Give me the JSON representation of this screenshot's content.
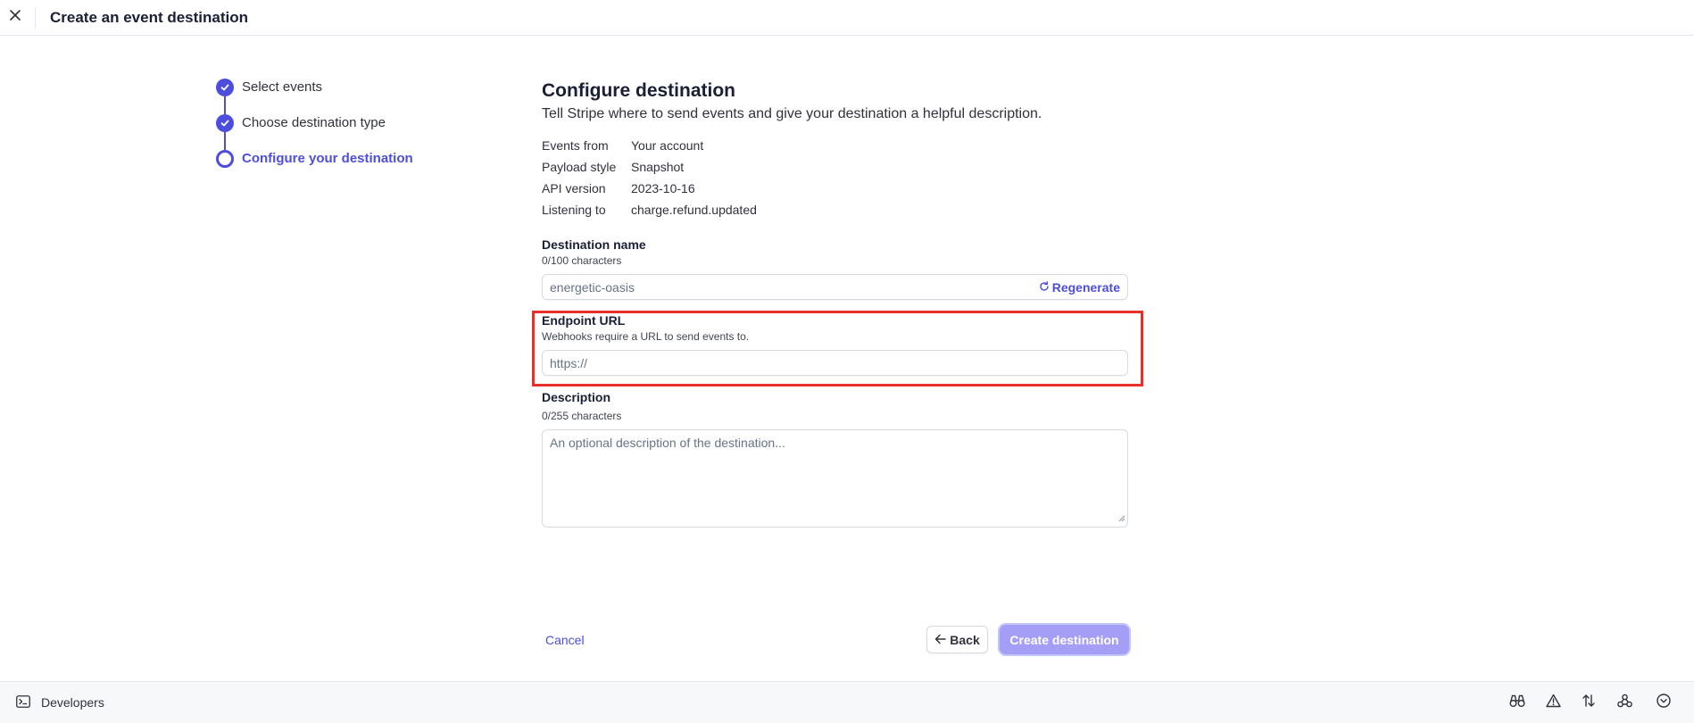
{
  "header": {
    "title": "Create an event destination",
    "close_icon": "close-icon"
  },
  "steps": [
    {
      "label": "Select events",
      "state": "done"
    },
    {
      "label": "Choose destination type",
      "state": "done"
    },
    {
      "label": "Configure your destination",
      "state": "current"
    }
  ],
  "main": {
    "heading": "Configure destination",
    "subtitle": "Tell Stripe where to send events and give your destination a helpful description.",
    "summary": [
      {
        "key": "Events from",
        "value": "Your account"
      },
      {
        "key": "Payload style",
        "value": "Snapshot"
      },
      {
        "key": "API version",
        "value": "2023-10-16"
      },
      {
        "key": "Listening to",
        "value": "charge.refund.updated"
      }
    ],
    "destination_name": {
      "label": "Destination name",
      "help": "0/100 characters",
      "placeholder": "energetic-oasis",
      "regenerate_label": "Regenerate"
    },
    "endpoint_url": {
      "label": "Endpoint URL",
      "help": "Webhooks require a URL to send events to.",
      "placeholder": "https://"
    },
    "description": {
      "label": "Description",
      "help": "0/255 characters",
      "placeholder": "An optional description of the destination..."
    }
  },
  "actions": {
    "cancel_label": "Cancel",
    "back_label": "Back",
    "create_label": "Create destination"
  },
  "bottom_bar": {
    "developers_label": "Developers",
    "tools": [
      "binoculars-icon",
      "warning-icon",
      "transfer-arrows-icon",
      "webhooks-icon",
      "chevron-down-circle-icon"
    ]
  },
  "colors": {
    "accent": "#4e4ede",
    "highlight": "#e8302a",
    "create_button": "#a59ef7"
  }
}
